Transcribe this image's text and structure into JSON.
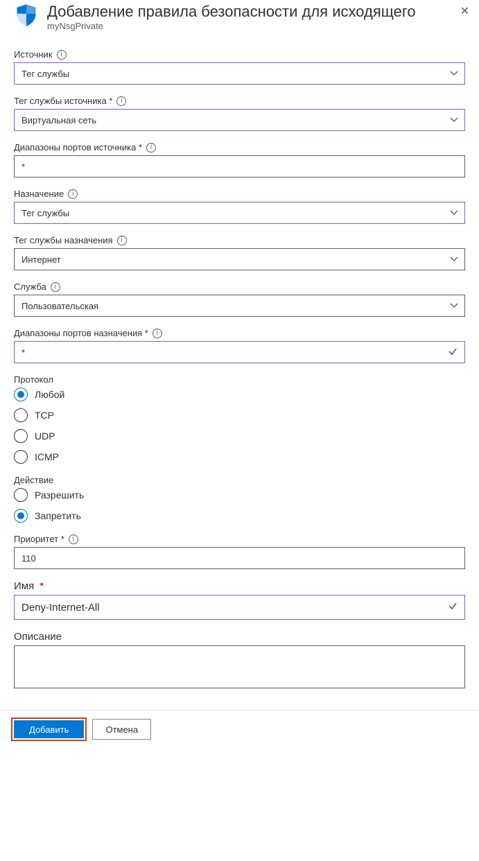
{
  "header": {
    "title": "Добавление правила безопасности для исходящего",
    "subtitle": "myNsgPrivate"
  },
  "fields": {
    "source": {
      "label": "Источник",
      "value": "Тег службы"
    },
    "sourceTag": {
      "label": "Тег службы источника *",
      "value": "Виртуальная сеть"
    },
    "sourcePorts": {
      "label": "Диапазоны портов источника *",
      "value": "*"
    },
    "destination": {
      "label": "Назначение",
      "value": "Тег службы"
    },
    "destTag": {
      "label": "Тег службы назначения",
      "value": "Интернет"
    },
    "service": {
      "label": "Служба",
      "value": "Пользовательская"
    },
    "destPorts": {
      "label": "Диапазоны портов назначения *",
      "value": "*"
    },
    "protocol": {
      "label": "Протокол",
      "options": [
        "Любой",
        "TCP",
        "UDP",
        "ICMP"
      ],
      "selected": "Любой"
    },
    "action": {
      "label": "Действие",
      "options": [
        "Разрешить",
        "Запретить"
      ],
      "selected": "Запретить"
    },
    "priority": {
      "label": "Приоритет *",
      "value": "110"
    },
    "name": {
      "label": "Имя",
      "value": "Deny-Internet-All"
    },
    "description": {
      "label": "Описание",
      "value": ""
    }
  },
  "footer": {
    "add": "Добавить",
    "cancel": "Отмена"
  }
}
